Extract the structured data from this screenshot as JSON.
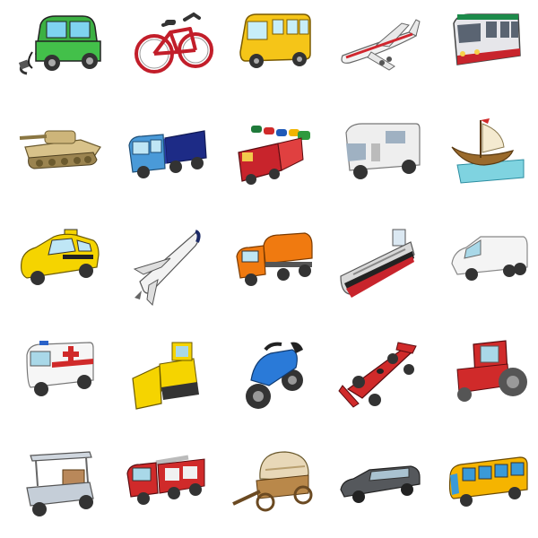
{
  "icons": [
    {
      "name": "electric-car-icon"
    },
    {
      "name": "bicycle-icon"
    },
    {
      "name": "school-bus-icon"
    },
    {
      "name": "airplane-icon"
    },
    {
      "name": "tram-icon"
    },
    {
      "name": "tank-icon"
    },
    {
      "name": "semi-truck-icon"
    },
    {
      "name": "toy-train-icon"
    },
    {
      "name": "camper-van-icon"
    },
    {
      "name": "sailing-ship-icon"
    },
    {
      "name": "taxi-icon"
    },
    {
      "name": "space-shuttle-icon"
    },
    {
      "name": "tanker-truck-icon"
    },
    {
      "name": "cargo-ship-icon"
    },
    {
      "name": "white-van-icon"
    },
    {
      "name": "ambulance-icon"
    },
    {
      "name": "bulldozer-icon"
    },
    {
      "name": "motorcycle-icon"
    },
    {
      "name": "race-car-icon"
    },
    {
      "name": "tractor-icon"
    },
    {
      "name": "golf-cart-icon"
    },
    {
      "name": "fire-truck-icon"
    },
    {
      "name": "covered-wagon-icon"
    },
    {
      "name": "limousine-icon"
    },
    {
      "name": "bus-icon"
    }
  ]
}
